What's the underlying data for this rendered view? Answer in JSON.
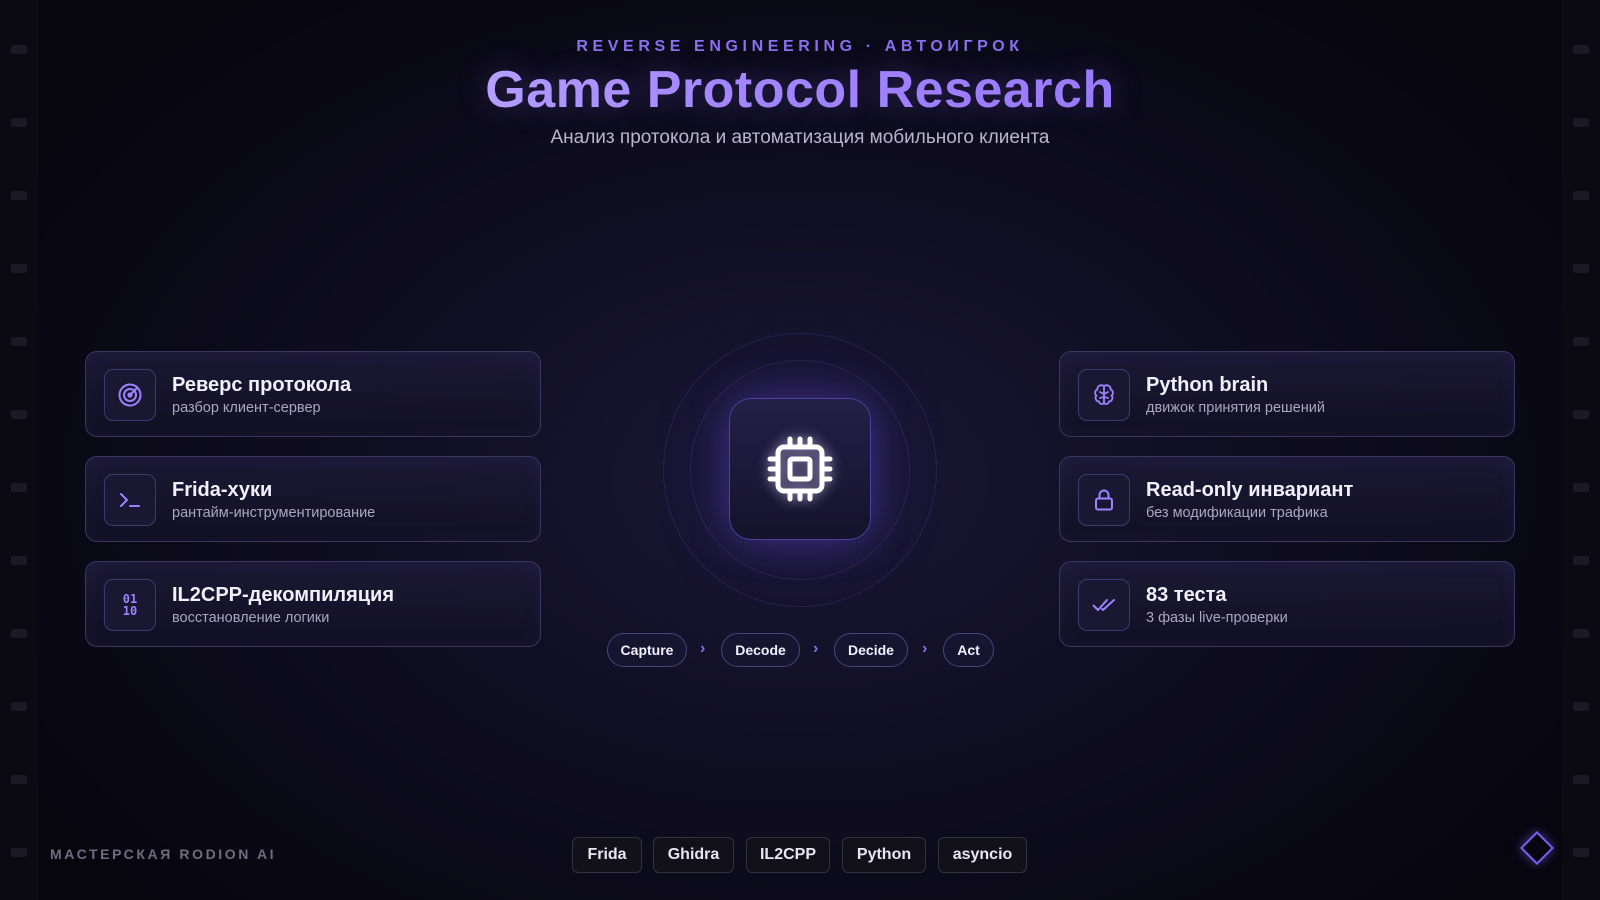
{
  "header": {
    "kicker": "REVERSE ENGINEERING · АВТОИГРОК",
    "title": "Game Protocol Research",
    "subtitle": "Анализ протокола и автоматизация мобильного клиента"
  },
  "left_cards": [
    {
      "title": "Реверс протокола",
      "subtitle": "разбор клиент-сервер",
      "icon": "radar-icon"
    },
    {
      "title": "Frida-хуки",
      "subtitle": "рантайм-инструментирование",
      "icon": "terminal-icon"
    },
    {
      "title": "IL2CPP-декомпиляция",
      "subtitle": "восстановление логики",
      "icon": "binary-icon",
      "icon_text_top": "01",
      "icon_text_bottom": "10"
    }
  ],
  "right_cards": [
    {
      "title": "Python brain",
      "subtitle": "движок принятия решений",
      "icon": "brain-icon"
    },
    {
      "title": "Read-only инвариант",
      "subtitle": "без модификации трафика",
      "icon": "lock-icon"
    },
    {
      "title": "83 теста",
      "subtitle": "3 фазы live-проверки",
      "icon": "double-check-icon"
    }
  ],
  "center": {
    "icon": "cpu-chip-icon"
  },
  "pipeline": {
    "steps": [
      "Capture",
      "Decode",
      "Decide",
      "Act"
    ],
    "separator_icon": "chevron-right-icon",
    "separator": "›"
  },
  "footer": {
    "brand": "МАСТЕРСКАЯ RODION AI",
    "tags": [
      "Frida",
      "Ghidra",
      "IL2CPP",
      "Python",
      "asyncio"
    ],
    "logo_icon": "diamond-icon"
  },
  "colors": {
    "accent": "#8a6ff0",
    "background": "#0d0b1a",
    "card_border": "#3b3560"
  }
}
